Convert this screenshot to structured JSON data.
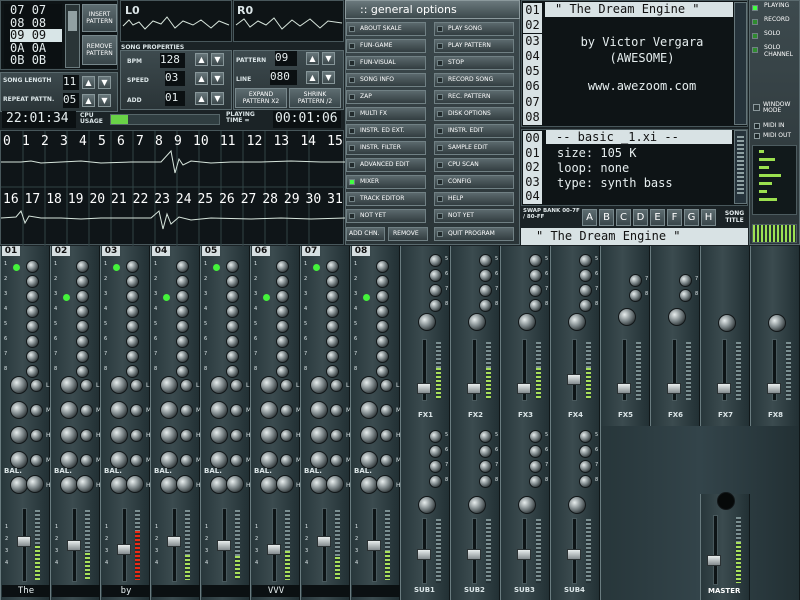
{
  "pattern_list": [
    "07",
    "08",
    "09",
    "0A",
    "0B"
  ],
  "pattern_list_right": [
    "07",
    "08",
    "09",
    "0A",
    "0B"
  ],
  "buttons_left": {
    "insert": "INSERT PATTERN",
    "remove": "REMOVE PATTERN"
  },
  "song_length": {
    "label": "SONG LENGTH",
    "value": "11"
  },
  "repeat_pattern": {
    "label": "REPEAT PATTN.",
    "value": "05"
  },
  "song_properties": "SONG PROPERTIES",
  "bpm": {
    "label": "BPM",
    "value": "128"
  },
  "speed": {
    "label": "SPEED",
    "value": "03"
  },
  "add": {
    "label": "ADD",
    "value": "01"
  },
  "pattern": {
    "label": "PATTERN",
    "value": "09"
  },
  "line": {
    "label": "LINE",
    "value": "080"
  },
  "expand_pattern": "EXPAND PATTERN X2",
  "shrink_pattern": "SHRINK PATTERN /2",
  "clock": "22:01:34",
  "cpu_usage": "CPU USAGE",
  "playing_time": {
    "label": "PLAYING TIME =",
    "value": "00:01:06"
  },
  "scope": {
    "left": "L0",
    "right": "R0"
  },
  "tracks_top": [
    "0",
    "1",
    "2",
    "3",
    "4",
    "5",
    "6",
    "7",
    "8",
    "9",
    "10",
    "11",
    "12",
    "13",
    "14",
    "15"
  ],
  "tracks_bottom": [
    "16",
    "17",
    "18",
    "19",
    "20",
    "21",
    "22",
    "23",
    "24",
    "25",
    "26",
    "27",
    "28",
    "29",
    "30",
    "31"
  ],
  "general_options": {
    "title": ":: general options",
    "left": [
      "ABOUT SKALE",
      "FUN-GAME",
      "FUN-VISUAL",
      "SONG INFO",
      "ZAP",
      "MULTI FX",
      "INSTR. ED EXT.",
      "INSTR. FILTER",
      "ADVANCED EDIT",
      "MIXER",
      "TRACK EDITOR",
      "NOT YET"
    ],
    "right": [
      "PLAY SONG",
      "PLAY PATTERN",
      "STOP",
      "RECORD SONG",
      "REC. PATTERN",
      "DISK OPTIONS",
      "INSTR. EDIT",
      "SAMPLE EDIT",
      "CPU SCAN",
      "CONFIG",
      "HELP",
      "NOT YET"
    ],
    "add_channel": "ADD CHN.",
    "remove": "REMOVE",
    "quit": "QUIT PROGRAM"
  },
  "song_info": {
    "numbers": [
      "01",
      "02",
      "03",
      "04",
      "05",
      "06",
      "07",
      "08"
    ],
    "title": "\" The Dream Engine \"",
    "lines": [
      "by Victor Vergara",
      "(AWESOME)",
      "www.awezoom.com"
    ]
  },
  "instrument": {
    "numbers": [
      "00",
      "01",
      "02",
      "03",
      "04"
    ],
    "name": "-- basic _1.xi --",
    "size": "size: 105 K",
    "loop": "loop: none",
    "type": "type: synth bass"
  },
  "swap_bank": "SWAP BANK 00-7F / 80-FF",
  "bank_letters": [
    "A",
    "B",
    "C",
    "D",
    "E",
    "F",
    "G",
    "H"
  ],
  "song_title": {
    "label": "SONG TITLE",
    "value": "\" The Dream Engine \""
  },
  "mode_buttons": [
    "PLAYING",
    "RECORD",
    "SOLO",
    "SOLO CHANNEL"
  ],
  "window_mode": "WINDOW MODE",
  "midi": [
    "MIDI IN",
    "MIDI OUT"
  ],
  "channels": [
    "01",
    "02",
    "03",
    "04",
    "05",
    "06",
    "07",
    "08"
  ],
  "channel_letters": [
    "1",
    "2",
    "3",
    "4",
    "5",
    "6",
    "7",
    "8"
  ],
  "channel_names": [
    "The",
    "",
    "by",
    "",
    "",
    "VVV",
    "",
    ""
  ],
  "mixer_side_letters": [
    "L",
    "M",
    "H",
    "M",
    "H"
  ],
  "fx_labels": [
    "FX1",
    "FX2",
    "FX3",
    "FX4",
    "FX5",
    "FX6",
    "FX7",
    "FX8"
  ],
  "fx_numbers": [
    "5",
    "6",
    "7",
    "8"
  ],
  "sub_labels": [
    "SUB1",
    "SUB2",
    "SUB3",
    "SUB4"
  ],
  "master": "MASTER",
  "bal": "BAL.",
  "meter_levels": [
    0.48,
    0.38,
    0.7,
    0.36,
    0.34,
    0.42,
    0.33,
    0.42
  ]
}
